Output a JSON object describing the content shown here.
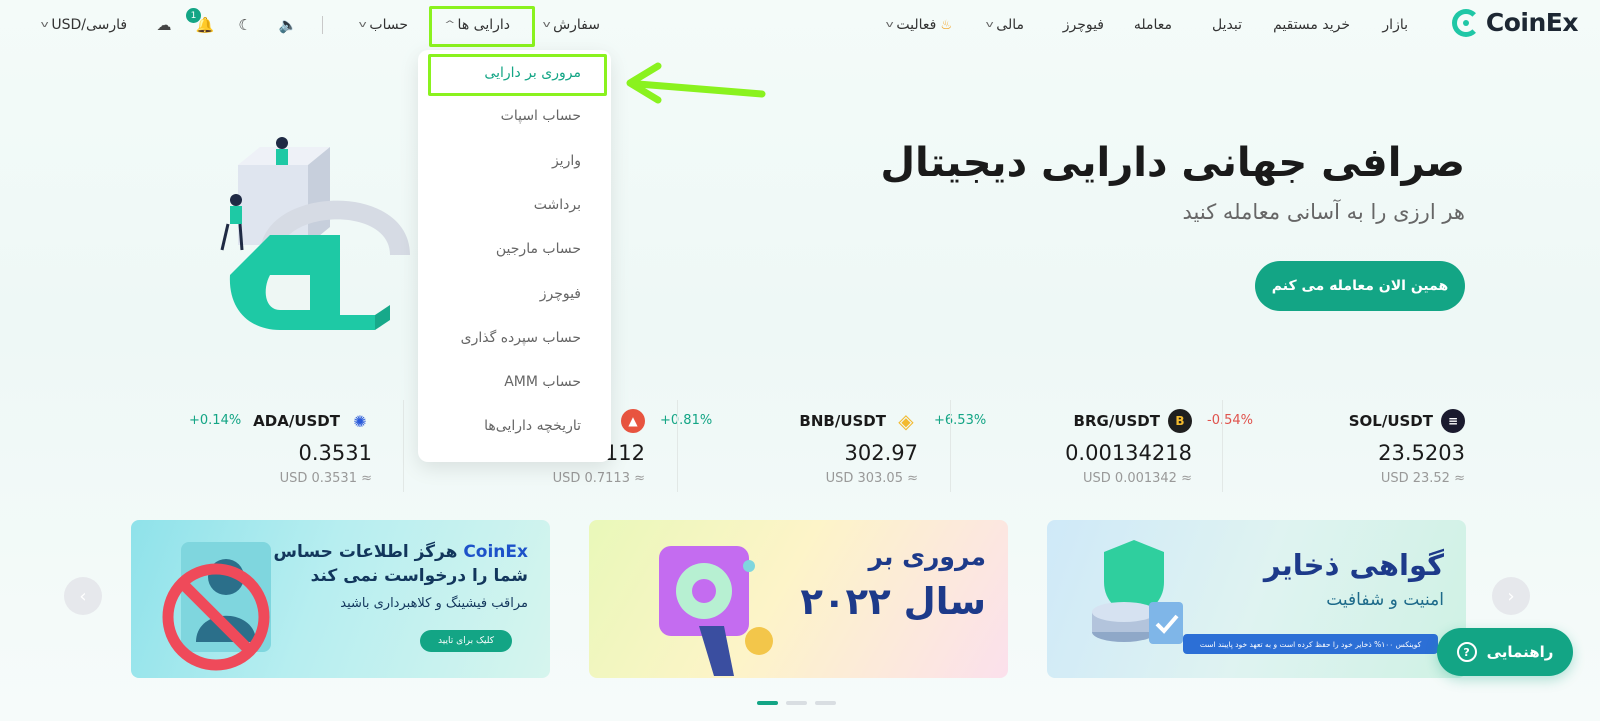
{
  "nav": {
    "logo_text": "CoinEx",
    "items": [
      {
        "label": "بازار"
      },
      {
        "label": "خرید مستقیم"
      },
      {
        "label": "تبدیل"
      },
      {
        "label": "معامله"
      },
      {
        "label": "فیوچرز"
      },
      {
        "label": "مالی"
      },
      {
        "label": "فعالیت"
      },
      {
        "label": "سفارش"
      },
      {
        "label": "دارایی ها"
      },
      {
        "label": "حساب"
      }
    ],
    "notification_count": "1",
    "language": "فارسی/USD",
    "currency": "USD"
  },
  "assets_dropdown": {
    "items": [
      {
        "label": "مروری بر دارایی"
      },
      {
        "label": "حساب اسپات"
      },
      {
        "label": "واریز"
      },
      {
        "label": "برداشت"
      },
      {
        "label": "حساب مارجین"
      },
      {
        "label": "فیوچرز"
      },
      {
        "label": "حساب سپرده گذاری"
      },
      {
        "label": "حساب AMM"
      },
      {
        "label": "تاریخچه دارایی‌ها"
      }
    ]
  },
  "hero": {
    "title": "صرافی جهانی دارایی دیجیتال",
    "subtitle": "هر ارزی را به آسانی معامله کنید",
    "cta": "همین الان معامله می کنم"
  },
  "tickers": [
    {
      "pair": "SOL/USDT",
      "change": "-0.54%",
      "price": "23.5203",
      "usd": "≈ USD 23.52",
      "color": "#1a1a2e",
      "icon": "S"
    },
    {
      "pair": "BRG/USDT",
      "change": "+6.53%",
      "price": "0.00134218",
      "usd": "≈ USD 0.001342",
      "color": "#1f1f1f",
      "icon": "B"
    },
    {
      "pair": "BNB/USDT",
      "change": "+0.81%",
      "price": "302.97",
      "usd": "≈ USD 303.05",
      "color": "#f3ba2f",
      "icon": "◆"
    },
    {
      "pair": "",
      "change": "",
      "price": "0.7112",
      "usd": "≈ USD 0.7113",
      "color": "#e8543f",
      "icon": "▲"
    },
    {
      "pair": "ADA/USDT",
      "change": "+0.14%",
      "price": "0.3531",
      "usd": "≈ USD 0.3531",
      "color": "#2a5ada",
      "icon": "✺"
    }
  ],
  "banners": {
    "b1": {
      "brand": "CoinEx",
      "line1": "هرگز اطلاعات حساس",
      "line2": "شما را درخواست نمی کند",
      "line3": "مراقب فیشینگ و کلاهبرداری باشید",
      "button": "کلیک برای تایید"
    },
    "b2": {
      "line1": "مروری بر",
      "line2": "سال ۲۰۲۲"
    },
    "b3": {
      "line1": "گواهی ذخایر",
      "line2": "امنیت و شفافیت",
      "note": "کوینکس ۱۰۰% ذخایر خود را حفظ کرده است و به تعهد خود پایبند است"
    }
  },
  "help_button": "راهنمایی",
  "colors": {
    "accent": "#13a585",
    "highlight": "#8af21e",
    "up": "#13a585",
    "down": "#e0534d"
  }
}
